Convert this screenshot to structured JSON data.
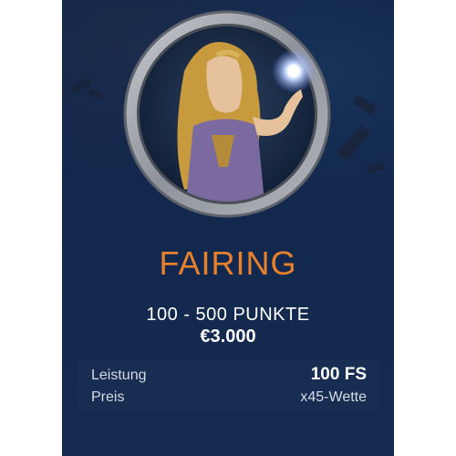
{
  "card": {
    "title": "FAIRING",
    "points_range": "100 - 500 PUNKTE",
    "prize_amount": "€3.000",
    "details": {
      "label_1": "Leistung",
      "label_2": "Preis",
      "value_main": "100 FS",
      "value_sub": "x45-Wette"
    }
  },
  "colors": {
    "background": "#102447",
    "title": "#e7812e",
    "info_box": "#172d52",
    "text": "#ffffff"
  },
  "icons": {
    "medallion": "character-portrait-medallion"
  }
}
